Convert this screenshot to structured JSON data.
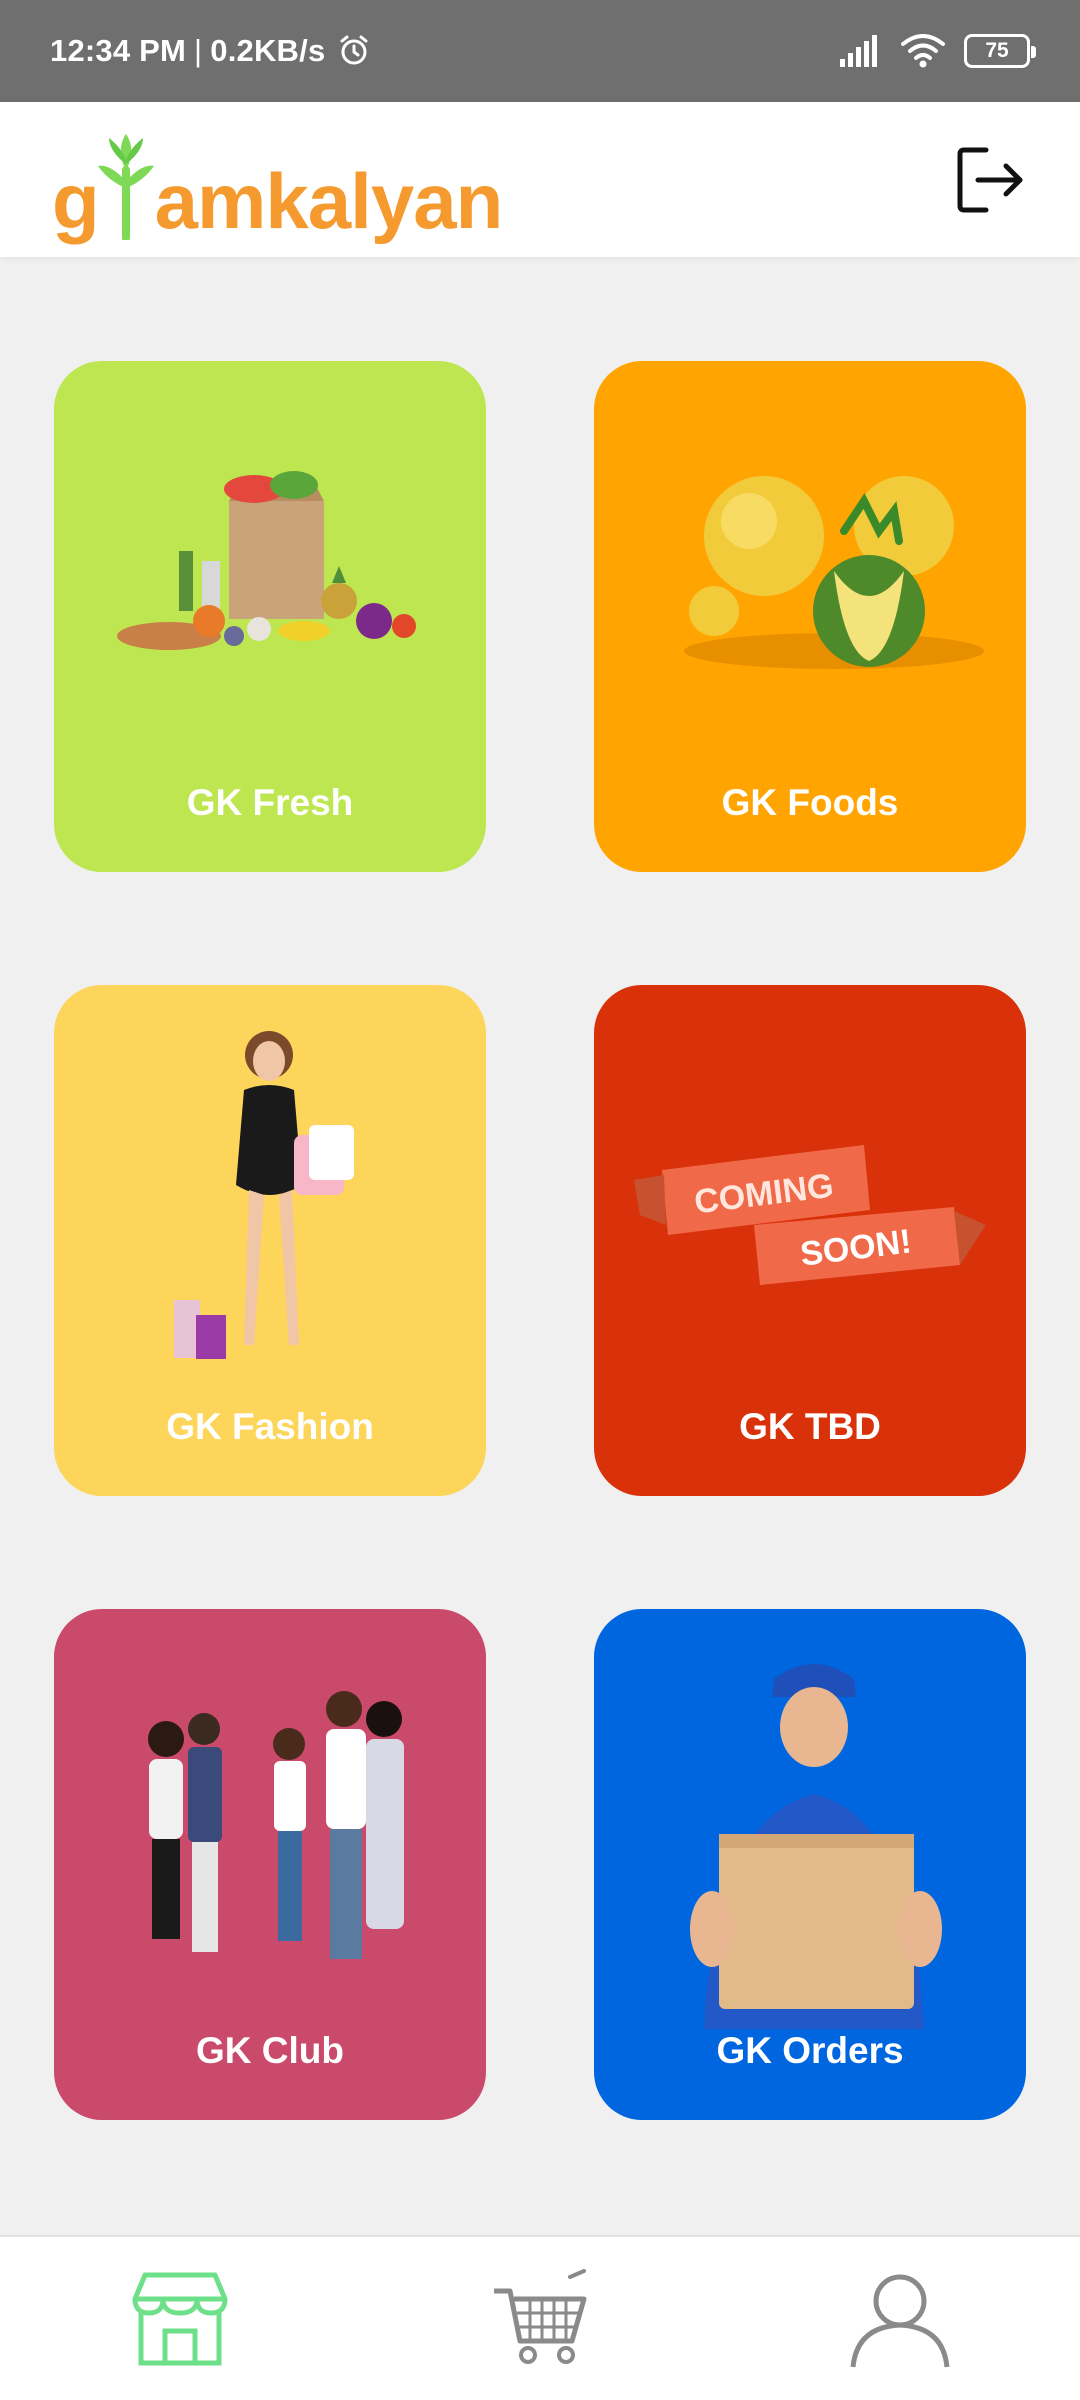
{
  "status_bar": {
    "time": "12:34 PM",
    "separator": "|",
    "network_speed": "0.2KB/s",
    "battery_level": "75",
    "icons": [
      "alarm-icon",
      "signal-icon",
      "wifi-icon",
      "battery-icon"
    ]
  },
  "app_bar": {
    "logo_text_left": "g",
    "logo_text_right": "amkalyan",
    "logo_mark": "sprout-icon",
    "logout_icon": "logout-icon"
  },
  "colors": {
    "fresh": "#bde650",
    "foods": "#ffa400",
    "fashion": "#fdd55a",
    "tbd": "#d9320a",
    "club": "#c94a6a",
    "orders": "#0066e0",
    "logo_orange": "#f59a2f",
    "logo_green": "#7ed957",
    "nav_active": "#6fe08a",
    "nav_inactive": "#8a8a8a"
  },
  "tiles": [
    {
      "label": "GK Fresh",
      "image": "grocery-bag-image"
    },
    {
      "label": "GK Foods",
      "image": "fruit-image"
    },
    {
      "label": "GK Fashion",
      "image": "shopping-woman-image"
    },
    {
      "label": "GK TBD",
      "image": "coming-soon-banner",
      "banner_line1": "COMING",
      "banner_line2": "SOON!"
    },
    {
      "label": "GK Club",
      "image": "friends-group-image"
    },
    {
      "label": "GK Orders",
      "image": "delivery-man-image"
    }
  ],
  "bottom_nav": [
    {
      "name": "store",
      "icon": "store-icon",
      "active": true
    },
    {
      "name": "cart",
      "icon": "cart-icon",
      "active": false
    },
    {
      "name": "profile",
      "icon": "profile-icon",
      "active": false
    }
  ]
}
